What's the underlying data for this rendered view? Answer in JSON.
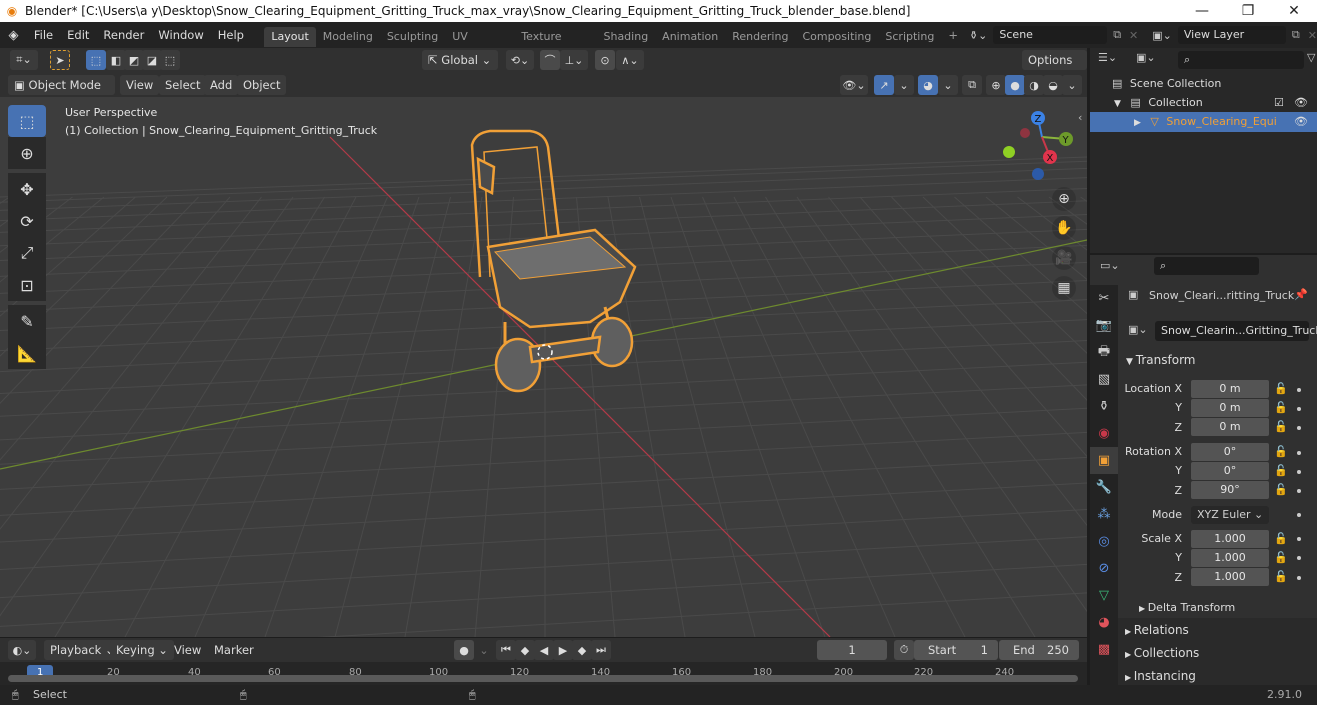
{
  "window": {
    "title": "Blender* [C:\\Users\\a y\\Desktop\\Snow_Clearing_Equipment_Gritting_Truck_max_vray\\Snow_Clearing_Equipment_Gritting_Truck_blender_base.blend]",
    "minimize": "—",
    "maximize": "❐",
    "close": "✕"
  },
  "menus": [
    "File",
    "Edit",
    "Render",
    "Window",
    "Help"
  ],
  "workspaces": [
    "Layout",
    "Modeling",
    "Sculpting",
    "UV Editing",
    "Texture Paint",
    "Shading",
    "Animation",
    "Rendering",
    "Compositing",
    "Scripting"
  ],
  "active_workspace": "Layout",
  "add_workspace": "+",
  "scene": {
    "name": "Scene",
    "view_layer": "View Layer"
  },
  "header": {
    "transform_orientation": "Global",
    "options": "Options",
    "mode": "Object Mode",
    "menus": [
      "View",
      "Select",
      "Add",
      "Object"
    ]
  },
  "viewport": {
    "perspective": "User Perspective",
    "collection_info": "(1) Collection | Snow_Clearing_Equipment_Gritting_Truck",
    "gizmo": {
      "x": "X",
      "y": "Y",
      "z": "Z"
    },
    "colors": {
      "selection": "#f1a037",
      "x_axis": "#c8384a",
      "y_axis": "#8ab43c",
      "z_axis": "#3b82e6"
    }
  },
  "outliner": {
    "scene_collection": "Scene Collection",
    "collection": "Collection",
    "object": "Snow_Clearing_Equi",
    "search_placeholder": ""
  },
  "properties": {
    "object_name": "Snow_Cleari...ritting_Truck",
    "data_name": "Snow_Clearin...Gritting_Truck",
    "transform_title": "Transform",
    "location_label": "Location X",
    "rotation_label": "Rotation X",
    "scale_label": "Scale X",
    "y": "Y",
    "z": "Z",
    "location": [
      "0 m",
      "0 m",
      "0 m"
    ],
    "rotation": [
      "0°",
      "0°",
      "90°"
    ],
    "mode_label": "Mode",
    "rotation_mode": "XYZ Euler",
    "scale": [
      "1.000",
      "1.000",
      "1.000"
    ],
    "delta_transform": "Delta Transform",
    "sections": [
      "Relations",
      "Collections",
      "Instancing"
    ]
  },
  "timeline": {
    "menus": [
      "Playback",
      "Keying",
      "View",
      "Marker"
    ],
    "current_frame": "1",
    "start_label": "Start",
    "start": "1",
    "end_label": "End",
    "end": "250",
    "ticks": [
      "1",
      "20",
      "40",
      "60",
      "80",
      "100",
      "120",
      "140",
      "160",
      "180",
      "200",
      "220",
      "240"
    ]
  },
  "status": {
    "select": "Select",
    "version": "2.91.0"
  }
}
